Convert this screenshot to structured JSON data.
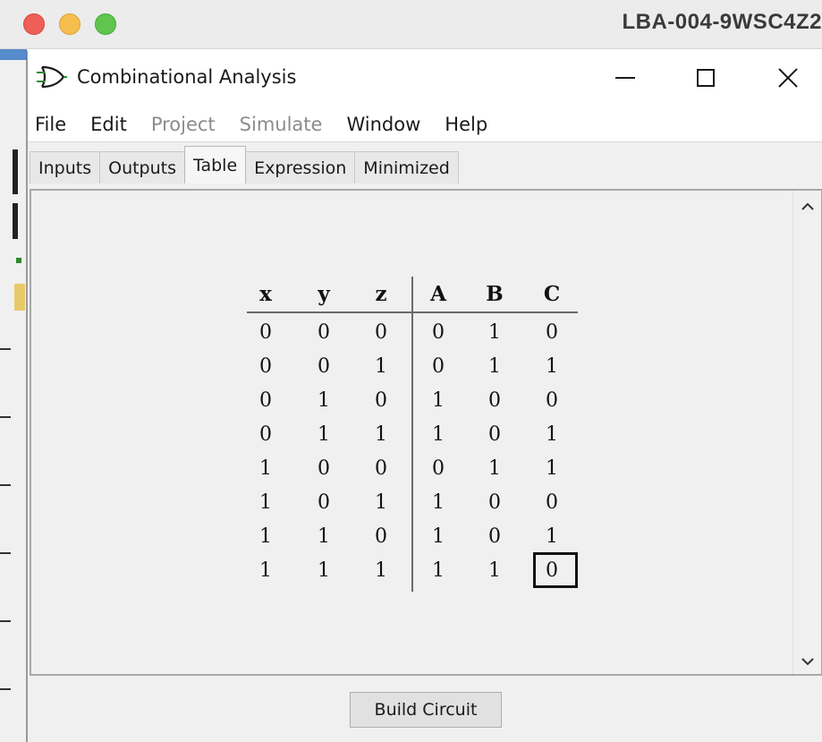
{
  "mac_window": {
    "title": "LBA-004-9WSC4Z2"
  },
  "window": {
    "title": "Combinational Analysis",
    "icon": "or-gate-icon"
  },
  "menu": [
    {
      "label": "File",
      "enabled": true
    },
    {
      "label": "Edit",
      "enabled": true
    },
    {
      "label": "Project",
      "enabled": false
    },
    {
      "label": "Simulate",
      "enabled": false
    },
    {
      "label": "Window",
      "enabled": true
    },
    {
      "label": "Help",
      "enabled": true
    }
  ],
  "tabs": [
    {
      "label": "Inputs",
      "active": false
    },
    {
      "label": "Outputs",
      "active": false
    },
    {
      "label": "Table",
      "active": true
    },
    {
      "label": "Expression",
      "active": false
    },
    {
      "label": "Minimized",
      "active": false
    }
  ],
  "truth_table": {
    "inputs": [
      "x",
      "y",
      "z"
    ],
    "outputs": [
      "A",
      "B",
      "C"
    ],
    "rows": [
      [
        "0",
        "0",
        "0",
        "0",
        "1",
        "0"
      ],
      [
        "0",
        "0",
        "1",
        "0",
        "1",
        "1"
      ],
      [
        "0",
        "1",
        "0",
        "1",
        "0",
        "0"
      ],
      [
        "0",
        "1",
        "1",
        "1",
        "0",
        "1"
      ],
      [
        "1",
        "0",
        "0",
        "0",
        "1",
        "1"
      ],
      [
        "1",
        "0",
        "1",
        "1",
        "0",
        "0"
      ],
      [
        "1",
        "1",
        "0",
        "1",
        "0",
        "1"
      ],
      [
        "1",
        "1",
        "1",
        "1",
        "1",
        "0"
      ]
    ],
    "selected_cell": {
      "row": 7,
      "column": 5
    }
  },
  "footer": {
    "build_button_label": "Build Circuit"
  },
  "colors": {
    "traffic_red": "#ee5f57",
    "traffic_yellow": "#f6be4f",
    "traffic_green": "#5fc54f",
    "panel_bg": "#f0f0f0"
  }
}
